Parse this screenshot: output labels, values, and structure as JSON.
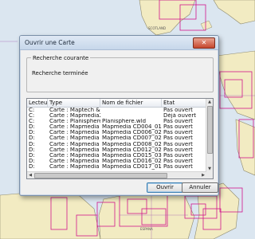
{
  "map": {
    "labels": [
      "SCOTLAND",
      "ESPANA"
    ]
  },
  "dialog": {
    "title": "Ouvrir une Carte",
    "close_label": "✕",
    "group_label": "Recherche courante",
    "status": "Recherche terminée",
    "columns": [
      "Lecteur",
      "Type",
      "Nom de fichier",
      "Etat"
    ],
    "rows": [
      [
        "C:",
        "Carte : Maptech & N...",
        "",
        "Pas ouvert"
      ],
      [
        "C:",
        "Carte : Mapmedia2 (*...",
        "",
        "Déjà ouvert"
      ],
      [
        "C:",
        "Carte : Planisphere/...",
        "Planisphere.wld",
        "Pas ouvert"
      ],
      [
        "D:",
        "Carte : Mapmedia (*...",
        "Mapmedia CD004_01 Islan...",
        "Pas ouvert"
      ],
      [
        "D:",
        "Carte : Mapmedia (*...",
        "Mapmedia CD006_02 Nor...",
        "Pas ouvert"
      ],
      [
        "D:",
        "Carte : Mapmedia (*...",
        "Mapmedia CD007_02 Nor...",
        "Pas ouvert"
      ],
      [
        "D:",
        "Carte : Mapmedia (*...",
        "Mapmedia CD008_02 Nor...",
        "Pas ouvert"
      ],
      [
        "D:",
        "Carte : Mapmedia (*...",
        "Mapmedia CD012_02 East...",
        "Pas ouvert"
      ],
      [
        "D:",
        "Carte : Mapmedia (*...",
        "Mapmedia CD015_03 Swe...",
        "Pas ouvert"
      ],
      [
        "D:",
        "Carte : Mapmedia (*...",
        "Mapmedia CD016_02 Swe...",
        "Pas ouvert"
      ],
      [
        "D:",
        "Carte : Mapmedia (*...",
        "Mapmedia CD017_01 Cat...",
        "Pas ouvert"
      ]
    ],
    "ok_label": "Ouvrir",
    "cancel_label": "Annuler"
  },
  "colors": {
    "sea": "#dbe6f0",
    "land": "#f2ebc2",
    "chart_outline": "#d1168c"
  }
}
